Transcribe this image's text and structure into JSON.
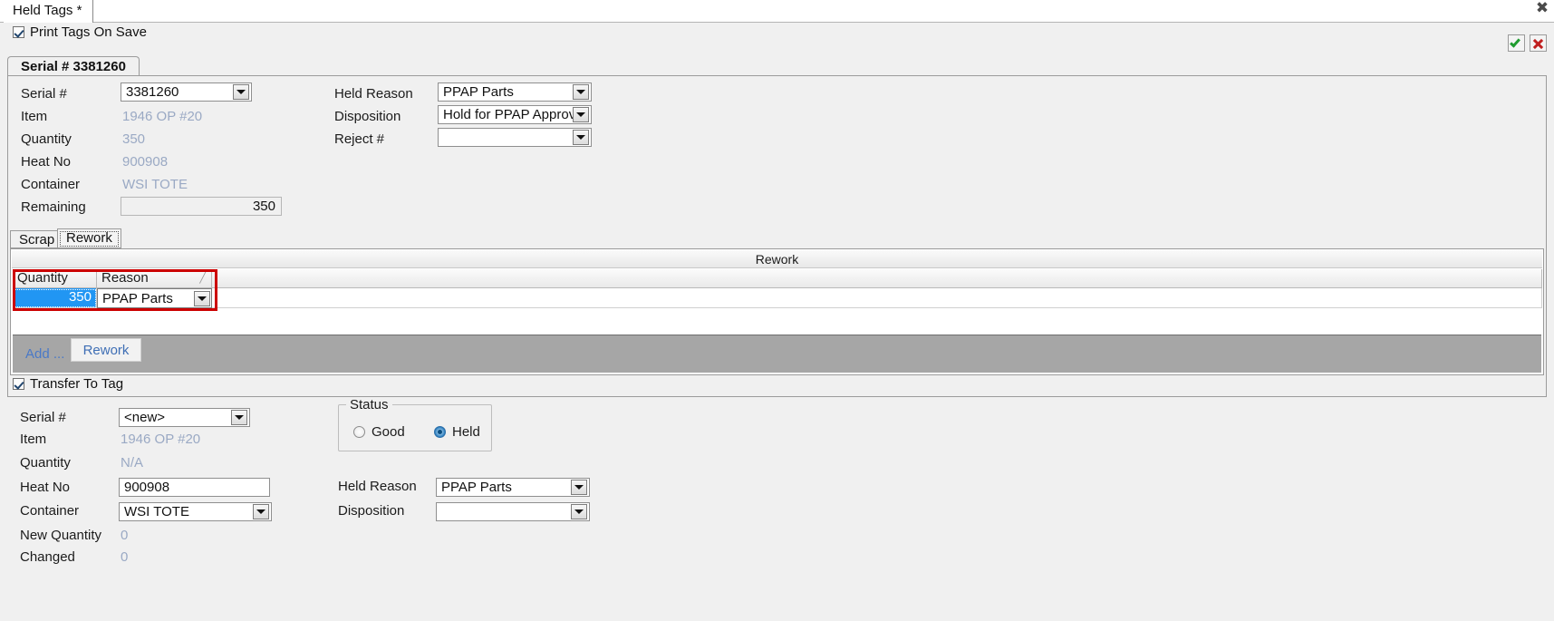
{
  "window": {
    "tab_title": "Held Tags *",
    "close_label": "✖"
  },
  "toolbar": {
    "print_tags_label": "Print Tags On Save",
    "print_tags_checked": true,
    "accept_icon": "check-icon",
    "cancel_icon": "close-icon"
  },
  "serial_panel": {
    "tab_label": "Serial # 3381260",
    "left_fields": [
      {
        "label": "Serial #",
        "value": "3381260",
        "type": "combo"
      },
      {
        "label": "Item",
        "value": "1946 OP #20",
        "type": "readonly"
      },
      {
        "label": "Quantity",
        "value": "350",
        "type": "readonly"
      },
      {
        "label": "Heat No",
        "value": "900908",
        "type": "readonly"
      },
      {
        "label": "Container",
        "value": "WSI TOTE",
        "type": "readonly"
      },
      {
        "label": "Remaining",
        "value": "350",
        "type": "readonly-box"
      }
    ],
    "right_fields": [
      {
        "label": "Held Reason",
        "value": "PPAP Parts",
        "type": "combo"
      },
      {
        "label": "Disposition",
        "value": "Hold for PPAP Approval",
        "type": "combo"
      },
      {
        "label": "Reject #",
        "value": "",
        "type": "combo"
      }
    ]
  },
  "sub_tabs": {
    "items": [
      {
        "label": "Scrap",
        "active": false
      },
      {
        "label": "Rework",
        "active": true
      }
    ],
    "panel_caption": "Rework",
    "grid": {
      "columns": [
        "Quantity",
        "Reason"
      ],
      "sort_indicator": "╱",
      "rows": [
        {
          "quantity": "350",
          "reason": "PPAP Parts"
        }
      ]
    },
    "buttons": {
      "add_label": "Add ...",
      "action_label": "Rework"
    },
    "highlight_color": "#cc0000"
  },
  "transfer": {
    "checkbox_label": "Transfer To Tag",
    "checked": true,
    "left_fields": [
      {
        "label": "Serial #",
        "value": "<new>",
        "type": "combo"
      },
      {
        "label": "Item",
        "value": "1946 OP #20",
        "type": "readonly"
      },
      {
        "label": "Quantity",
        "value": "N/A",
        "type": "readonly"
      },
      {
        "label": "Heat No",
        "value": "900908",
        "type": "textbox"
      },
      {
        "label": "Container",
        "value": "WSI TOTE",
        "type": "combo"
      },
      {
        "label": "New Quantity",
        "value": "0",
        "type": "readonly"
      },
      {
        "label": "Changed",
        "value": "0",
        "type": "readonly"
      }
    ],
    "status_group": {
      "title": "Status",
      "options": [
        {
          "label": "Good",
          "selected": false
        },
        {
          "label": "Held",
          "selected": true
        }
      ]
    },
    "right_fields": [
      {
        "label": "Held Reason",
        "value": "PPAP Parts",
        "type": "combo"
      },
      {
        "label": "Disposition",
        "value": "",
        "type": "combo"
      }
    ]
  }
}
